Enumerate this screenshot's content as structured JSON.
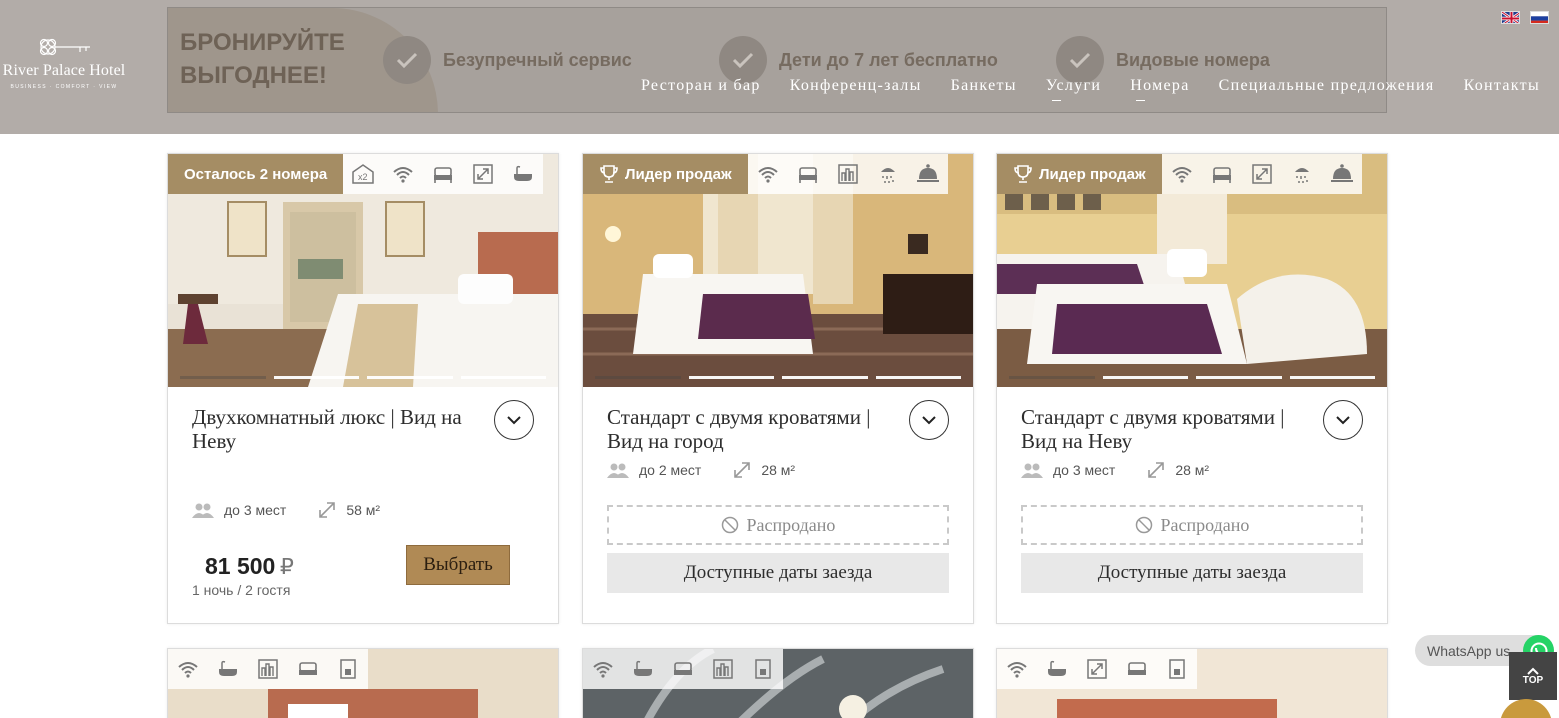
{
  "header": {
    "logo": {
      "name": "River Palace Hotel",
      "tagline": "BUSINESS · COMFORT · VIEW"
    },
    "banner": {
      "title_line1": "БРОНИРУЙТЕ",
      "title_line2": "ВЫГОДНЕЕ!",
      "features": [
        "Безупречный сервис",
        "Дети до 7 лет бесплатно",
        "Видовые номера"
      ]
    },
    "nav": [
      "Ресторан и бар",
      "Конференц-залы",
      "Банкеты",
      "Услуги",
      "Номера",
      "Специальные предложения",
      "Контакты"
    ],
    "languages": [
      "en-flag-icon",
      "ru-flag-icon"
    ]
  },
  "cards": [
    {
      "badge": "Осталось 2 номера",
      "title": "Двухкомнатный люкс | Вид на Неву",
      "guests": "до 3 мест",
      "area": "58 м²",
      "price": "81 500",
      "currency": "₽",
      "price_sub": "1 ночь / 2 гостя",
      "select": "Выбрать"
    },
    {
      "badge": "Лидер продаж",
      "title": "Стандарт с двумя кроватями | Вид на город",
      "guests": "до 2 мест",
      "area": "28 м²",
      "soldout": "Распродано",
      "dates": "Доступные даты заезда"
    },
    {
      "badge": "Лидер продаж",
      "title": "Стандарт с двумя кроватями | Вид на Неву",
      "guests": "до 3 мест",
      "area": "28 м²",
      "soldout": "Распродано",
      "dates": "Доступные даты заезда"
    }
  ],
  "widgets": {
    "whatsapp": "WhatsApp us",
    "top": "TOP"
  },
  "colors": {
    "gold": "#b08a55",
    "badge": "#a58d64",
    "header": "#b2aca8"
  }
}
